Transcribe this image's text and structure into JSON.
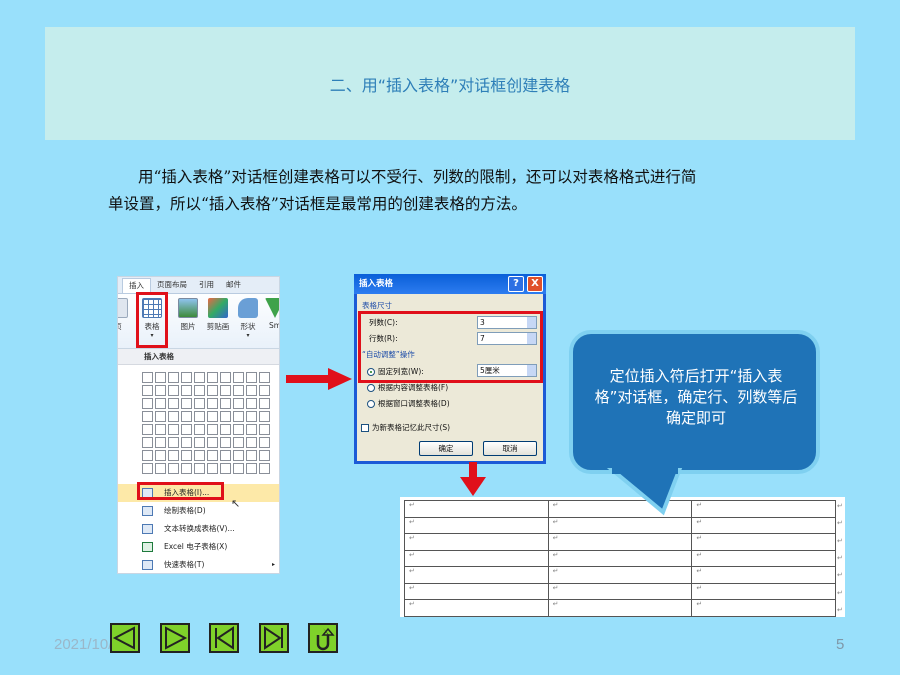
{
  "title": "二、用“插入表格”对话框创建表格",
  "paragraph": {
    "line1": "用“插入表格”对话框创建表格可以不受行、列数的限制，还可以对表格格式进行简",
    "line2": "单设置，所以“插入表格”对话框是最常用的创建表格的方法。"
  },
  "ribbon": {
    "tabs": [
      "插入",
      "页面布局",
      "引用",
      "邮件"
    ],
    "buttons": [
      "页",
      "表格",
      "图片",
      "剪贴画",
      "形状",
      "Sm"
    ],
    "dropdown_header": "插入表格",
    "grid_rows": 8,
    "grid_cols": 10,
    "menu_items": [
      "插入表格(I)...",
      "绘制表格(D)",
      "文本转换成表格(V)...",
      "Excel 电子表格(X)",
      "快速表格(T)"
    ]
  },
  "dialog": {
    "title": "插入表格",
    "help": "?",
    "close": "X",
    "section_size": "表格尺寸",
    "cols_label": "列数(C):",
    "cols_value": "3",
    "rows_label": "行数(R):",
    "rows_value": "7",
    "section_autofit": "“自动调整”操作",
    "fixed_width": "固定列宽(W):",
    "fixed_width_value": "5厘米",
    "fit_content": "根据内容调整表格(F)",
    "fit_window": "根据窗口调整表格(D)",
    "remember": "为新表格记忆此尺寸(S)",
    "ok": "确定",
    "cancel": "取消"
  },
  "callout": "定位插入符后打开“插入表格”对话框，确定行、列数等后确定即可",
  "result_table": {
    "rows": 7,
    "cols": 3,
    "mark": "↵"
  },
  "footer": {
    "date": "2021/10/10",
    "page": "5"
  },
  "colors": {
    "background": "#99e0fb",
    "title_box": "#c5eded",
    "title_text": "#2e7fb8",
    "highlight": "#e0101a",
    "callout": "#1f73b7",
    "nav_green": "#7fd12a"
  }
}
